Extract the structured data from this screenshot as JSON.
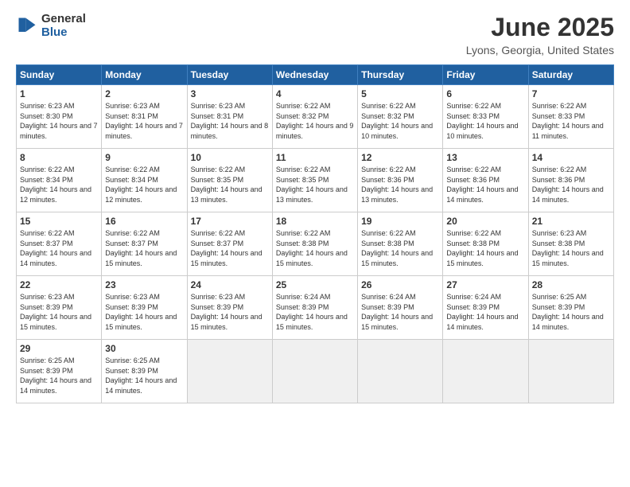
{
  "logo": {
    "general": "General",
    "blue": "Blue"
  },
  "title": "June 2025",
  "location": "Lyons, Georgia, United States",
  "headers": [
    "Sunday",
    "Monday",
    "Tuesday",
    "Wednesday",
    "Thursday",
    "Friday",
    "Saturday"
  ],
  "weeks": [
    [
      {
        "day": "1",
        "sunrise": "6:23 AM",
        "sunset": "8:30 PM",
        "daylight": "14 hours and 7 minutes."
      },
      {
        "day": "2",
        "sunrise": "6:23 AM",
        "sunset": "8:31 PM",
        "daylight": "14 hours and 7 minutes."
      },
      {
        "day": "3",
        "sunrise": "6:23 AM",
        "sunset": "8:31 PM",
        "daylight": "14 hours and 8 minutes."
      },
      {
        "day": "4",
        "sunrise": "6:22 AM",
        "sunset": "8:32 PM",
        "daylight": "14 hours and 9 minutes."
      },
      {
        "day": "5",
        "sunrise": "6:22 AM",
        "sunset": "8:32 PM",
        "daylight": "14 hours and 10 minutes."
      },
      {
        "day": "6",
        "sunrise": "6:22 AM",
        "sunset": "8:33 PM",
        "daylight": "14 hours and 10 minutes."
      },
      {
        "day": "7",
        "sunrise": "6:22 AM",
        "sunset": "8:33 PM",
        "daylight": "14 hours and 11 minutes."
      }
    ],
    [
      {
        "day": "8",
        "sunrise": "6:22 AM",
        "sunset": "8:34 PM",
        "daylight": "14 hours and 12 minutes."
      },
      {
        "day": "9",
        "sunrise": "6:22 AM",
        "sunset": "8:34 PM",
        "daylight": "14 hours and 12 minutes."
      },
      {
        "day": "10",
        "sunrise": "6:22 AM",
        "sunset": "8:35 PM",
        "daylight": "14 hours and 13 minutes."
      },
      {
        "day": "11",
        "sunrise": "6:22 AM",
        "sunset": "8:35 PM",
        "daylight": "14 hours and 13 minutes."
      },
      {
        "day": "12",
        "sunrise": "6:22 AM",
        "sunset": "8:36 PM",
        "daylight": "14 hours and 13 minutes."
      },
      {
        "day": "13",
        "sunrise": "6:22 AM",
        "sunset": "8:36 PM",
        "daylight": "14 hours and 14 minutes."
      },
      {
        "day": "14",
        "sunrise": "6:22 AM",
        "sunset": "8:36 PM",
        "daylight": "14 hours and 14 minutes."
      }
    ],
    [
      {
        "day": "15",
        "sunrise": "6:22 AM",
        "sunset": "8:37 PM",
        "daylight": "14 hours and 14 minutes."
      },
      {
        "day": "16",
        "sunrise": "6:22 AM",
        "sunset": "8:37 PM",
        "daylight": "14 hours and 15 minutes."
      },
      {
        "day": "17",
        "sunrise": "6:22 AM",
        "sunset": "8:37 PM",
        "daylight": "14 hours and 15 minutes."
      },
      {
        "day": "18",
        "sunrise": "6:22 AM",
        "sunset": "8:38 PM",
        "daylight": "14 hours and 15 minutes."
      },
      {
        "day": "19",
        "sunrise": "6:22 AM",
        "sunset": "8:38 PM",
        "daylight": "14 hours and 15 minutes."
      },
      {
        "day": "20",
        "sunrise": "6:22 AM",
        "sunset": "8:38 PM",
        "daylight": "14 hours and 15 minutes."
      },
      {
        "day": "21",
        "sunrise": "6:23 AM",
        "sunset": "8:38 PM",
        "daylight": "14 hours and 15 minutes."
      }
    ],
    [
      {
        "day": "22",
        "sunrise": "6:23 AM",
        "sunset": "8:39 PM",
        "daylight": "14 hours and 15 minutes."
      },
      {
        "day": "23",
        "sunrise": "6:23 AM",
        "sunset": "8:39 PM",
        "daylight": "14 hours and 15 minutes."
      },
      {
        "day": "24",
        "sunrise": "6:23 AM",
        "sunset": "8:39 PM",
        "daylight": "14 hours and 15 minutes."
      },
      {
        "day": "25",
        "sunrise": "6:24 AM",
        "sunset": "8:39 PM",
        "daylight": "14 hours and 15 minutes."
      },
      {
        "day": "26",
        "sunrise": "6:24 AM",
        "sunset": "8:39 PM",
        "daylight": "14 hours and 15 minutes."
      },
      {
        "day": "27",
        "sunrise": "6:24 AM",
        "sunset": "8:39 PM",
        "daylight": "14 hours and 14 minutes."
      },
      {
        "day": "28",
        "sunrise": "6:25 AM",
        "sunset": "8:39 PM",
        "daylight": "14 hours and 14 minutes."
      }
    ],
    [
      {
        "day": "29",
        "sunrise": "6:25 AM",
        "sunset": "8:39 PM",
        "daylight": "14 hours and 14 minutes."
      },
      {
        "day": "30",
        "sunrise": "6:25 AM",
        "sunset": "8:39 PM",
        "daylight": "14 hours and 14 minutes."
      },
      {
        "day": "",
        "sunrise": "",
        "sunset": "",
        "daylight": ""
      },
      {
        "day": "",
        "sunrise": "",
        "sunset": "",
        "daylight": ""
      },
      {
        "day": "",
        "sunrise": "",
        "sunset": "",
        "daylight": ""
      },
      {
        "day": "",
        "sunrise": "",
        "sunset": "",
        "daylight": ""
      },
      {
        "day": "",
        "sunrise": "",
        "sunset": "",
        "daylight": ""
      }
    ]
  ],
  "labels": {
    "sunrise": "Sunrise:",
    "sunset": "Sunset:",
    "daylight": "Daylight:"
  }
}
